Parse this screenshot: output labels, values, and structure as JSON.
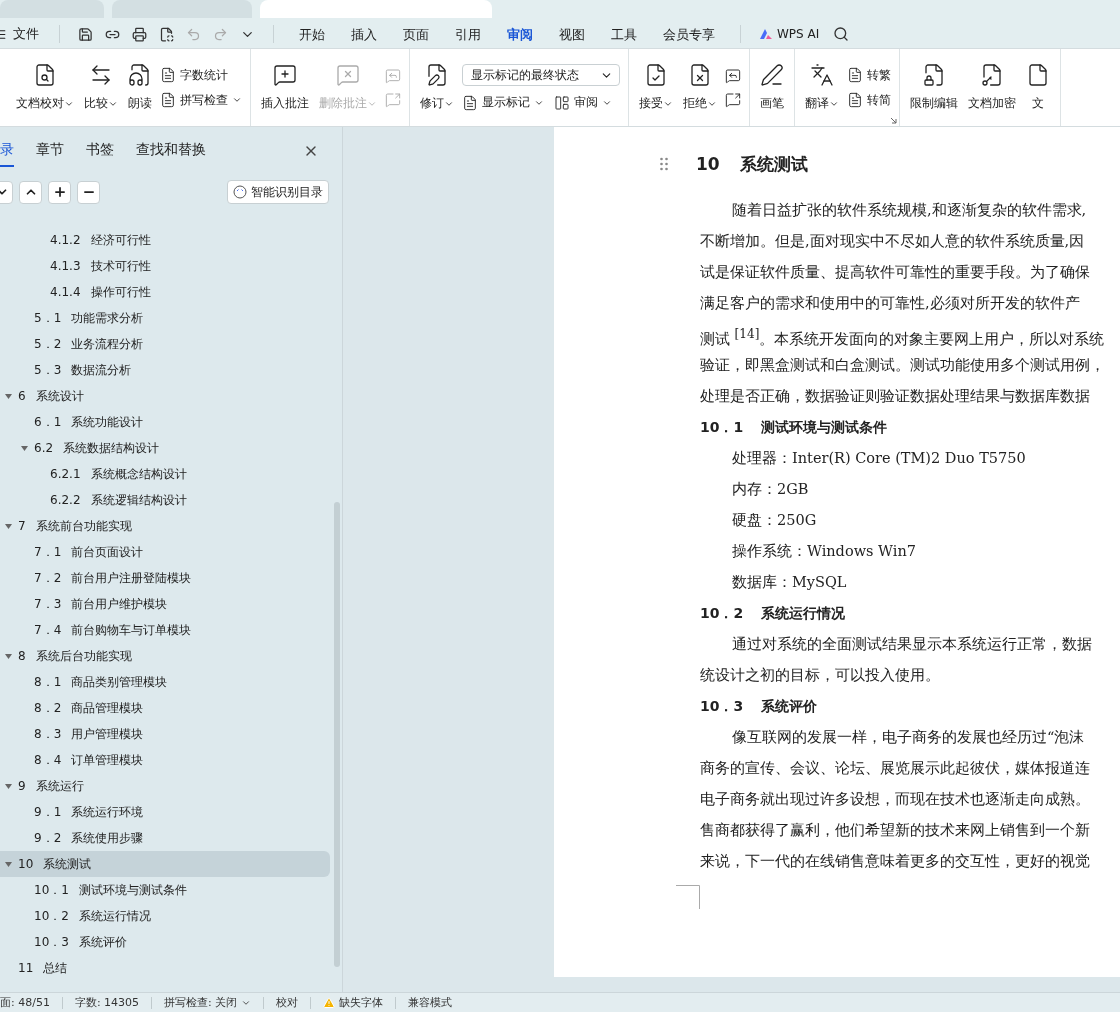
{
  "window_tabs": [
    {
      "selected": false
    },
    {
      "selected": false
    },
    {
      "selected": true
    }
  ],
  "menu_bar": {
    "file": "文件",
    "tabs": [
      {
        "label": "开始",
        "selected": false
      },
      {
        "label": "插入",
        "selected": false
      },
      {
        "label": "页面",
        "selected": false
      },
      {
        "label": "引用",
        "selected": false
      },
      {
        "label": "审阅",
        "selected": true
      },
      {
        "label": "视图",
        "selected": false
      },
      {
        "label": "工具",
        "selected": false
      },
      {
        "label": "会员专享",
        "selected": false
      }
    ],
    "ai": "WPS AI"
  },
  "ribbon": [
    {
      "items": [
        {
          "kind": "large",
          "label": "文档校对",
          "caret": true,
          "disabled": false
        },
        {
          "kind": "large",
          "label": "比较",
          "caret": true,
          "disabled": false
        },
        {
          "kind": "large",
          "label": "朗读",
          "caret": false,
          "disabled": false
        },
        {
          "kind": "column",
          "rows": [
            [
              {
                "label": "字数统计",
                "caret": false,
                "disabled": false
              }
            ],
            [
              {
                "label": "拼写检查",
                "caret": true,
                "disabled": false
              }
            ]
          ]
        }
      ]
    },
    {
      "items": [
        {
          "kind": "large",
          "label": "插入批注",
          "caret": false,
          "disabled": false
        },
        {
          "kind": "large",
          "label": "删除批注",
          "caret": true,
          "disabled": true
        },
        {
          "kind": "column",
          "rows": [
            [
              {
                "caret": false,
                "disabled": true
              }
            ],
            [
              {
                "caret": false,
                "disabled": true
              }
            ]
          ]
        }
      ]
    },
    {
      "items": [
        {
          "kind": "large",
          "label": "修订",
          "caret": true,
          "disabled": false
        },
        {
          "kind": "column",
          "rows": [
            [
              {
                "kind": "select",
                "value": "显示标记的最终状态"
              }
            ],
            [
              {
                "label": "显示标记",
                "caret": true,
                "disabled": false
              },
              {
                "label": "审阅",
                "caret": true,
                "disabled": false
              }
            ]
          ]
        }
      ]
    },
    {
      "items": [
        {
          "kind": "large",
          "label": "接受",
          "caret": true,
          "disabled": false
        },
        {
          "kind": "large",
          "label": "拒绝",
          "caret": true,
          "disabled": false
        },
        {
          "kind": "column",
          "rows": [
            [
              {
                "caret": false,
                "disabled": false
              }
            ],
            [
              {
                "caret": false,
                "disabled": false
              }
            ]
          ]
        }
      ]
    },
    {
      "items": [
        {
          "kind": "large",
          "label": "画笔",
          "caret": false,
          "disabled": false
        }
      ]
    },
    {
      "items": [
        {
          "kind": "large",
          "label": "翻译",
          "caret": true,
          "disabled": false
        },
        {
          "kind": "column",
          "rows": [
            [
              {
                "label": "转繁",
                "caret": false,
                "disabled": false
              }
            ],
            [
              {
                "label": "转简",
                "caret": false,
                "disabled": false
              }
            ]
          ]
        }
      ],
      "launcher": true
    },
    {
      "items": [
        {
          "kind": "large",
          "label": "限制编辑",
          "caret": false,
          "disabled": false
        },
        {
          "kind": "large",
          "label": "文档加密",
          "caret": false,
          "disabled": false
        },
        {
          "kind": "large",
          "label": "文",
          "caret": false,
          "disabled": false
        }
      ]
    }
  ],
  "sidebar": {
    "tabs": [
      {
        "label": "录",
        "selected": true
      },
      {
        "label": "章节",
        "selected": false
      },
      {
        "label": "书签",
        "selected": false
      },
      {
        "label": "查找和替换",
        "selected": false
      }
    ],
    "smart_button": "智能识别目录",
    "toc": [
      {
        "children": [
          {
            "children": [
              {
                "number": "4.1.2",
                "title": "经济可行性",
                "selected": false
              },
              {
                "number": "4.1.3",
                "title": "技术可行性",
                "selected": false
              },
              {
                "number": "4.1.4",
                "title": "操作可行性",
                "selected": false
              }
            ]
          },
          {
            "number": "5．1",
            "title": "功能需求分析",
            "selected": false
          },
          {
            "number": "5．2",
            "title": "业务流程分析",
            "selected": false
          },
          {
            "number": "5．3",
            "title": "数据流分析",
            "selected": false
          }
        ]
      },
      {
        "number": "6",
        "title": "系统设计",
        "selected": false,
        "expanded": true,
        "children": [
          {
            "number": "6．1",
            "title": "系统功能设计",
            "selected": false
          },
          {
            "number": "6.2",
            "title": "系统数据结构设计",
            "selected": false,
            "expanded": true,
            "children": [
              {
                "number": "6.2.1",
                "title": "系统概念结构设计",
                "selected": false
              },
              {
                "number": "6.2.2",
                "title": "系统逻辑结构设计",
                "selected": false
              }
            ]
          }
        ]
      },
      {
        "number": "7",
        "title": "系统前台功能实现",
        "selected": false,
        "expanded": true,
        "children": [
          {
            "number": "7．1",
            "title": "前台页面设计",
            "selected": false
          },
          {
            "number": "7．2",
            "title": "前台用户注册登陆模块",
            "selected": false
          },
          {
            "number": "7．3",
            "title": "前台用户维护模块",
            "selected": false
          },
          {
            "number": "7．4",
            "title": "前台购物车与订单模块",
            "selected": false
          }
        ]
      },
      {
        "number": "8",
        "title": "系统后台功能实现",
        "selected": false,
        "expanded": true,
        "children": [
          {
            "number": "8．1",
            "title": "商品类别管理模块",
            "selected": false
          },
          {
            "number": "8．2",
            "title": "商品管理模块",
            "selected": false
          },
          {
            "number": "8．3",
            "title": "用户管理模块",
            "selected": false
          },
          {
            "number": "8．4",
            "title": "订单管理模块",
            "selected": false
          }
        ]
      },
      {
        "number": "9",
        "title": "系统运行",
        "selected": false,
        "expanded": true,
        "children": [
          {
            "number": "9．1",
            "title": "系统运行环境",
            "selected": false
          },
          {
            "number": "9．2",
            "title": "系统使用步骤",
            "selected": false
          }
        ]
      },
      {
        "number": "10",
        "title": "系统测试",
        "selected": true,
        "expanded": true,
        "children": [
          {
            "number": "10．1",
            "title": "测试环境与测试条件",
            "selected": false
          },
          {
            "number": "10．2",
            "title": "系统运行情况",
            "selected": false
          },
          {
            "number": "10．3",
            "title": "系统评价",
            "selected": false
          }
        ]
      },
      {
        "number": "11",
        "title": "总结",
        "selected": false
      }
    ]
  },
  "document": [
    {
      "kind": "h1",
      "number": "10",
      "title": "系统测试"
    },
    {
      "kind": "para",
      "lines": [
        "随着日益扩张的软件系统规模,和逐渐复杂的软件需求,",
        "不断增加。但是,面对现实中不尽如人意的软件系统质量,因",
        "试是保证软件质量、提高软件可靠性的重要手段。为了确保",
        "满足客户的需求和使用中的可靠性,必须对所开发的软件产",
        "测试 $^{[14]}$。本系统开发面向的对象主要网上用户，所以对系统",
        "验证，即黑盒测试和白盒测试。测试功能使用多个测试用例，",
        "处理是否正确，数据验证则验证数据处理结果与数据库数据"
      ]
    },
    {
      "kind": "h2",
      "number": "10．1",
      "title": "测试环境与测试条件"
    },
    {
      "kind": "item",
      "lines": [
        "处理器：Inter(R) Core (TM)2 Duo T5750"
      ]
    },
    {
      "kind": "item",
      "lines": [
        "内存：2GB"
      ]
    },
    {
      "kind": "item",
      "lines": [
        "硬盘：250G"
      ]
    },
    {
      "kind": "item",
      "lines": [
        "操作系统：Windows Win7"
      ]
    },
    {
      "kind": "item",
      "lines": [
        "数据库：MySQL"
      ]
    },
    {
      "kind": "h2",
      "number": "10．2",
      "title": "系统运行情况"
    },
    {
      "kind": "para",
      "lines": [
        "通过对系统的全面测试结果显示本系统运行正常，数据",
        "统设计之初的目标，可以投入使用。"
      ]
    },
    {
      "kind": "h2",
      "number": "10．3",
      "title": "系统评价"
    },
    {
      "kind": "para",
      "lines": [
        "像互联网的发展一样，电子商务的发展也经历过“泡沫",
        "商务的宣传、会议、论坛、展览展示此起彼伏，媒体报道连",
        "电子商务就出现过许多设想，而现在技术也逐渐走向成熟。",
        "售商都获得了赢利，他们希望新的技术来网上销售到一个新",
        "来说，下一代的在线销售意味着更多的交互性，更好的视觉"
      ]
    }
  ],
  "status_bar": [
    {
      "kind": "text",
      "label": "面: 48/51"
    },
    {
      "kind": "text",
      "label": "字数: 14305"
    },
    {
      "kind": "menu",
      "label": "拼写检查: 关闭"
    },
    {
      "kind": "text",
      "label": "校对"
    },
    {
      "kind": "warning",
      "label": "缺失字体"
    },
    {
      "kind": "text",
      "label": "兼容模式"
    }
  ]
}
